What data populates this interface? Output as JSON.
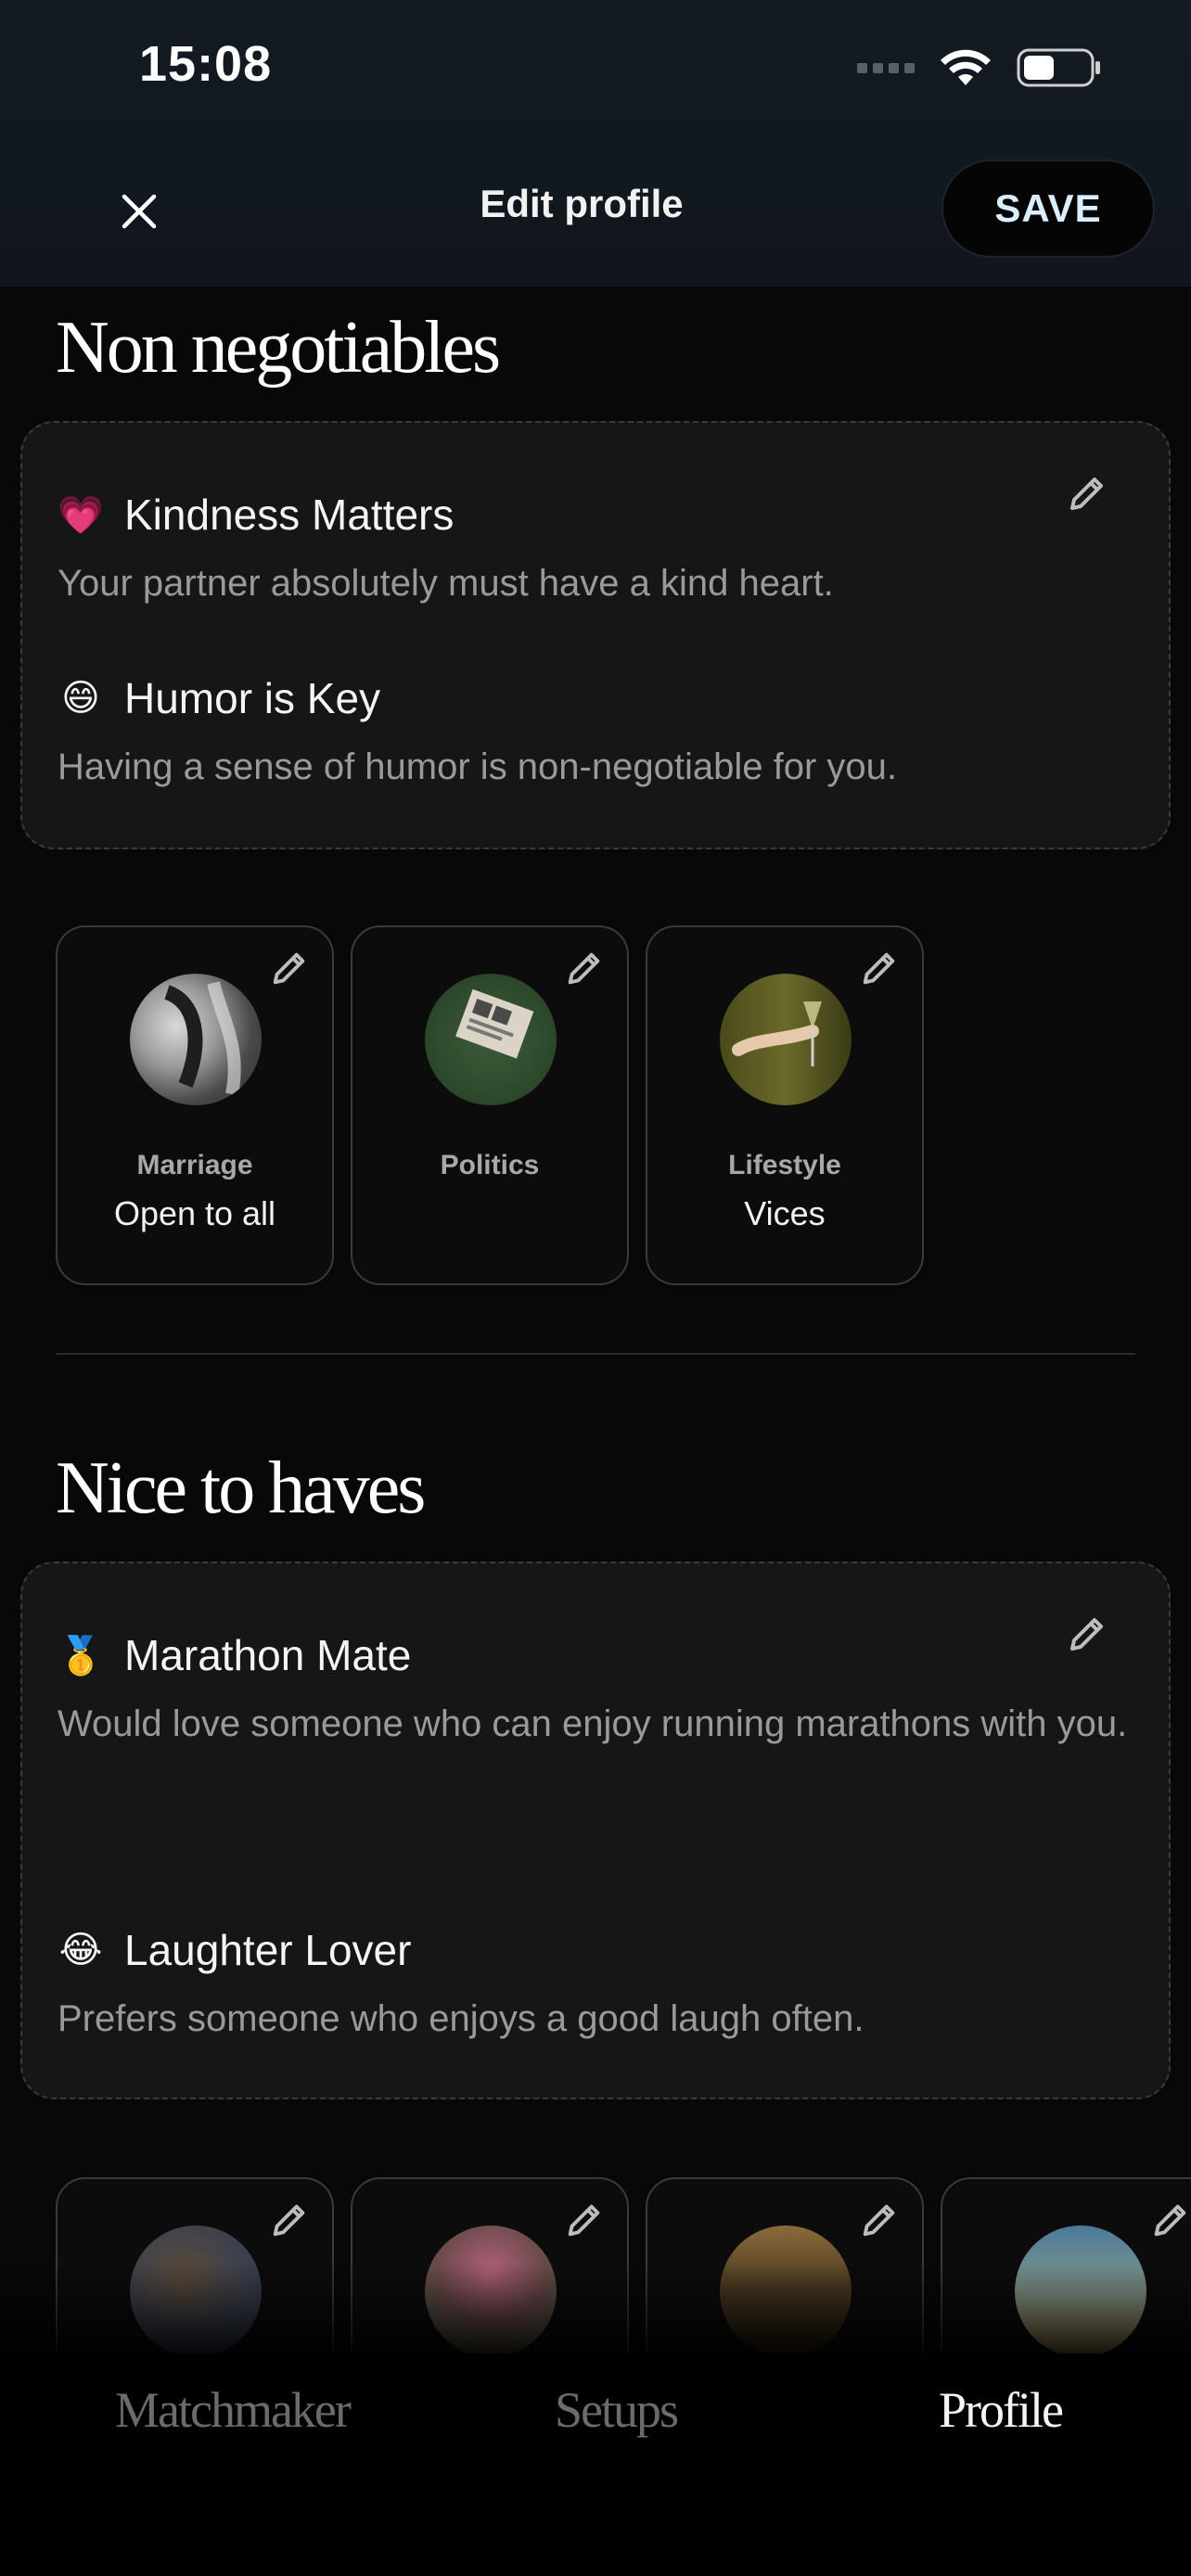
{
  "status_bar": {
    "time": "15:08"
  },
  "header": {
    "title": "Edit profile",
    "save_label": "SAVE"
  },
  "non_negotiables": {
    "heading": "Non negotiables",
    "items": [
      {
        "emoji": "💗",
        "title": "Kindness Matters",
        "description": "Your partner absolutely must have a kind heart."
      },
      {
        "emoji": "😄",
        "title": "Humor is Key",
        "description": "Having a sense of humor is non-negotiable for you."
      }
    ],
    "tiles": [
      {
        "label": "Marriage",
        "value": "Open to all"
      },
      {
        "label": "Politics",
        "value": ""
      },
      {
        "label": "Lifestyle",
        "value": "Vices"
      }
    ]
  },
  "nice_to_haves": {
    "heading": "Nice to haves",
    "items": [
      {
        "emoji": "🥇",
        "title": "Marathon Mate",
        "description": "Would love someone who can enjoy running marathons with you."
      },
      {
        "emoji": "😂",
        "title": "Laughter Lover",
        "description": "Prefers someone who enjoys a good laugh often."
      }
    ]
  },
  "tabs": [
    {
      "label": "Matchmaker",
      "active": false
    },
    {
      "label": "Setups",
      "active": false
    },
    {
      "label": "Profile",
      "active": true
    }
  ],
  "icons": {
    "close": "close-icon",
    "pencil": "pencil-icon",
    "wifi": "wifi-icon",
    "battery": "battery-icon",
    "signal": "signal-icon"
  },
  "colors": {
    "save_text": "#dbeefd",
    "background": "#080808",
    "card": "#161616",
    "muted": "#9a9a9a"
  }
}
